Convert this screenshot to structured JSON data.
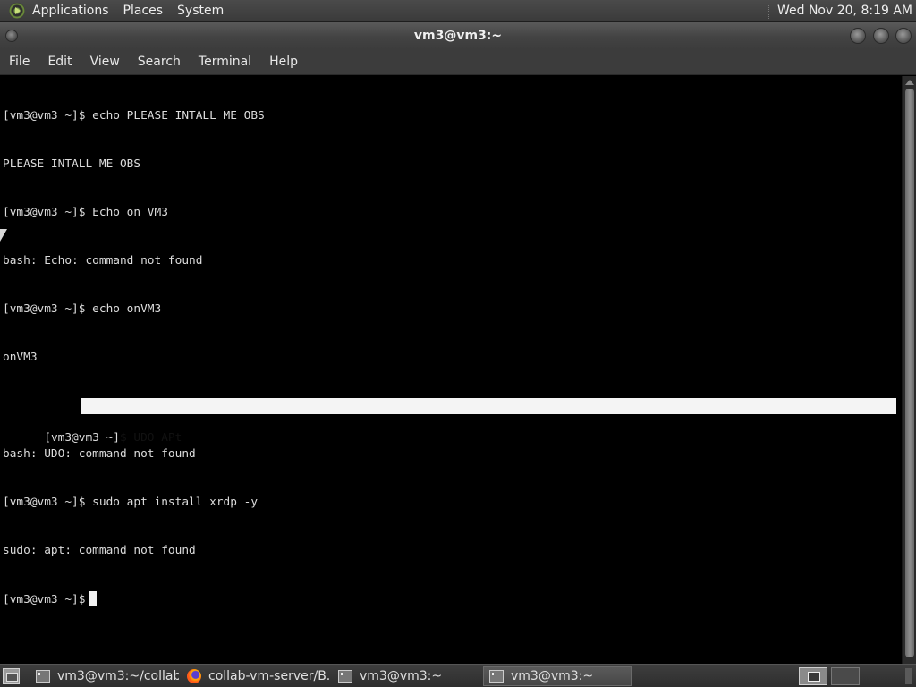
{
  "top_panel": {
    "applications": "Applications",
    "places": "Places",
    "system": "System",
    "clock": "Wed Nov 20,  8:19 AM"
  },
  "window": {
    "title": "vm3@vm3:~"
  },
  "menubar": {
    "file": "File",
    "edit": "Edit",
    "view": "View",
    "search": "Search",
    "terminal": "Terminal",
    "help": "Help"
  },
  "terminal": {
    "lines": [
      "[vm3@vm3 ~]$ echo PLEASE INTALL ME OBS",
      "PLEASE INTALL ME OBS",
      "[vm3@vm3 ~]$ Echo on VM3",
      "bash: Echo: command not found",
      "[vm3@vm3 ~]$ echo onVM3",
      "onVM3"
    ],
    "selected_prompt": "[vm3@vm3 ~]",
    "selected_text": "$ UDO APt",
    "lines_after": [
      "bash: UDO: command not found",
      "[vm3@vm3 ~]$ sudo apt install xrdp -y",
      "sudo: apt: command not found"
    ],
    "current_prompt": "[vm3@vm3 ~]$"
  },
  "taskbar": {
    "tasks": [
      {
        "label": "vm3@vm3:~/collab...",
        "icon": "terminal-icon"
      },
      {
        "label": "collab-vm-server/B...",
        "icon": "firefox-icon"
      },
      {
        "label": "vm3@vm3:~",
        "icon": "terminal-icon"
      },
      {
        "label": "vm3@vm3:~",
        "icon": "terminal-icon"
      }
    ]
  },
  "colors": {
    "panel": "#3c3c3c",
    "terminal_bg": "#000000",
    "terminal_fg": "#dcdcdc",
    "selection": "#f4f4f4"
  }
}
